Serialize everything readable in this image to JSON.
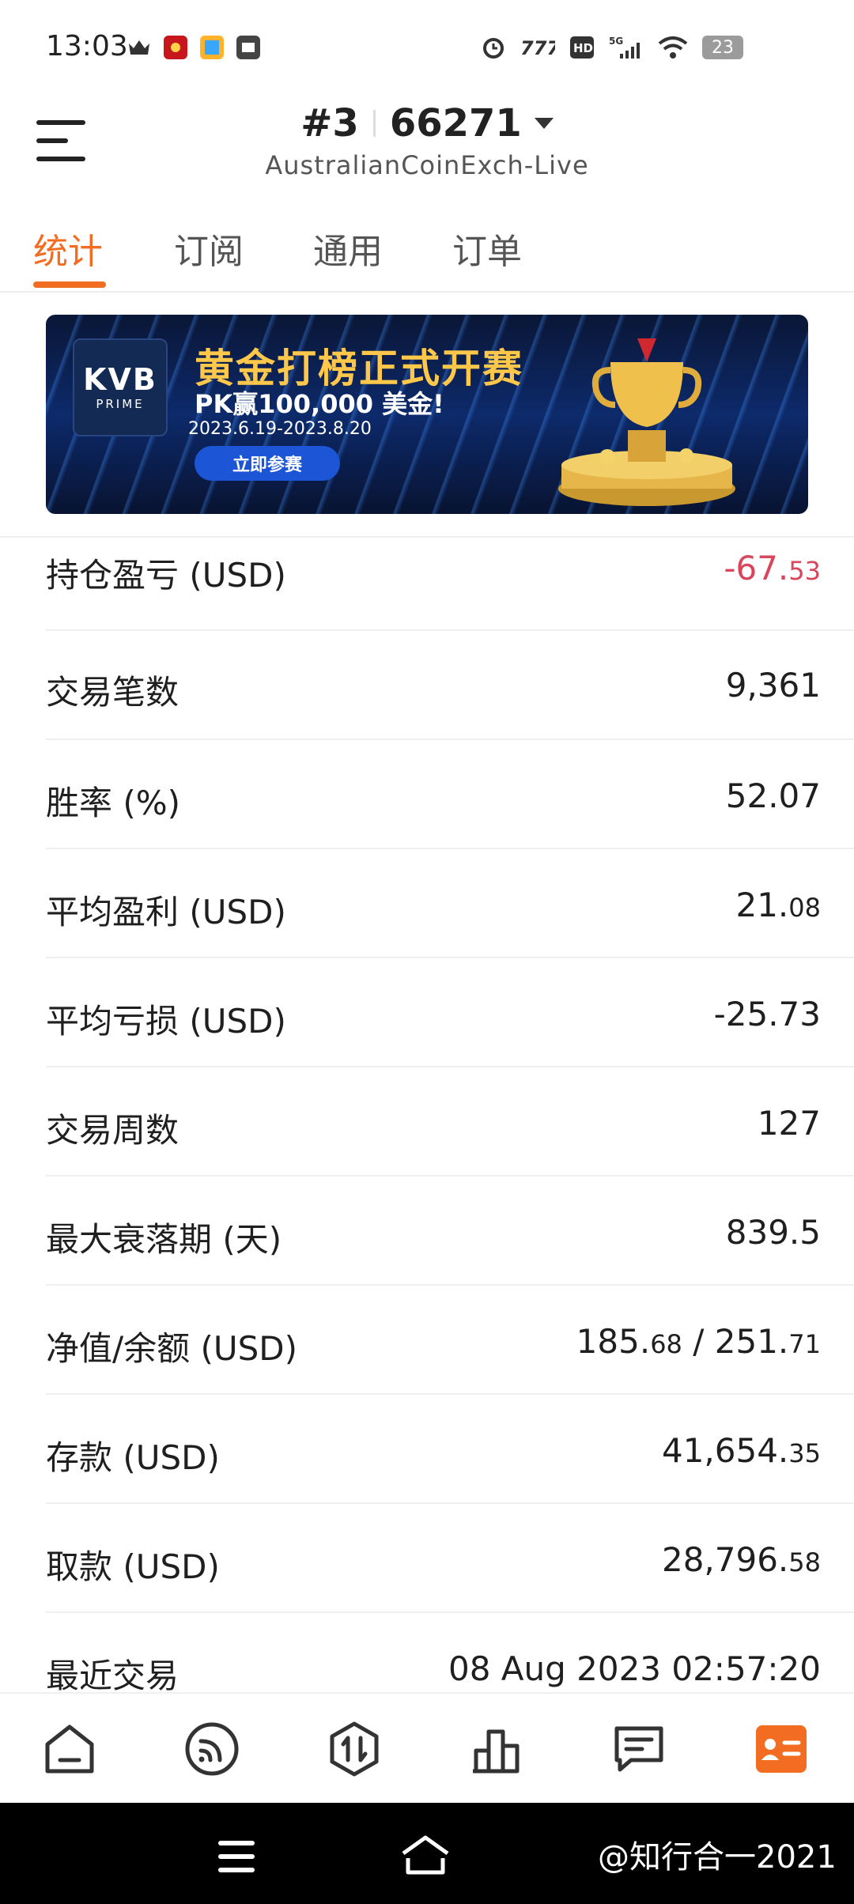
{
  "status_bar": {
    "time": "13:03",
    "left_icons": [
      "crown-icon",
      "red-app-icon",
      "photo-app-icon",
      "wallet-app-icon"
    ],
    "right_icons": [
      "alarm-icon",
      "carrier-777-icon",
      "hd-icon",
      "5g-signal-icon",
      "wifi-icon"
    ],
    "battery": "23"
  },
  "header": {
    "account_prefix": "#3",
    "account_number": "66271",
    "server": "AustralianCoinExch-Live"
  },
  "tabs": [
    {
      "label": "统计",
      "active": true
    },
    {
      "label": "订阅",
      "active": false
    },
    {
      "label": "通用",
      "active": false
    },
    {
      "label": "订单",
      "active": false
    }
  ],
  "banner": {
    "logo_main": "KVB",
    "logo_sub": "PRIME",
    "title": "黄金打榜正式开赛",
    "subtitle": "PK赢100,000 美金!",
    "dates": "2023.6.19-2023.8.20",
    "button": "立即参赛"
  },
  "stats": [
    {
      "label": "持仓盈亏 (USD)",
      "main": "-67.",
      "small": "53",
      "negative": true
    },
    {
      "label": "交易笔数",
      "main": "9,361",
      "small": ""
    },
    {
      "label": "胜率 (%)",
      "main": "52.07",
      "small": ""
    },
    {
      "label": "平均盈利 (USD)",
      "main": "21.",
      "small": "08"
    },
    {
      "label": "平均亏损 (USD)",
      "main": "-25.73",
      "small": ""
    },
    {
      "label": "交易周数",
      "main": "127",
      "small": ""
    },
    {
      "label": "最大衰落期 (天)",
      "main": "839.5",
      "small": ""
    },
    {
      "label": "净值/余额 (USD)",
      "main": "185.",
      "small": "68",
      "main2": " / 251.",
      "small2": "71"
    },
    {
      "label": "存款 (USD)",
      "main": "41,654.",
      "small": "35"
    },
    {
      "label": "取款 (USD)",
      "main": "28,796.",
      "small": "58"
    },
    {
      "label": "最近交易",
      "main": "08 Aug 2023 02:57:20",
      "small": ""
    }
  ],
  "bottom_nav": [
    "home-icon",
    "signal-icon",
    "trade-icon",
    "chart-icon",
    "messages-icon",
    "profile-icon"
  ],
  "accent_color": "#f26d21",
  "negative_color": "#d7465a",
  "watermark": "@知行合一2021"
}
